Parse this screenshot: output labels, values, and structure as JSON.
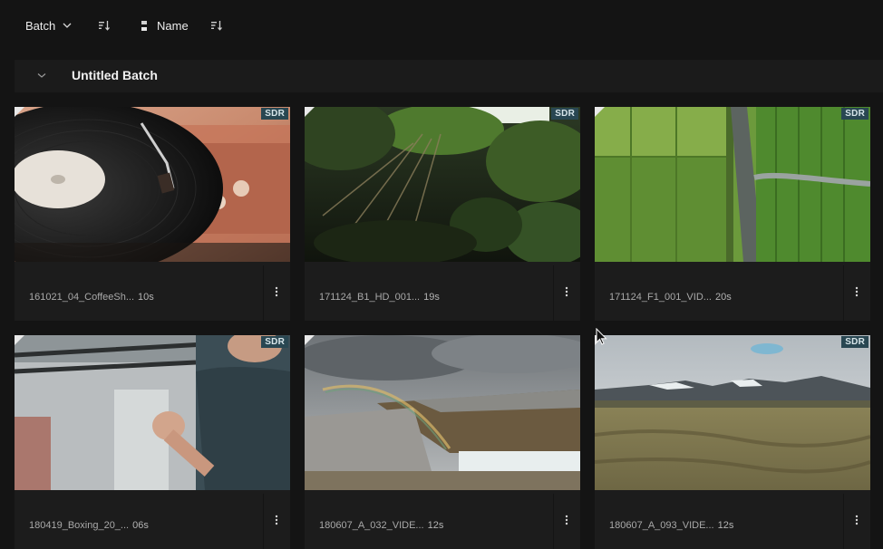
{
  "toolbar": {
    "batch_label": "Batch",
    "name_label": "Name"
  },
  "batch": {
    "title": "Untitled Batch"
  },
  "badge": "SDR",
  "clips": [
    {
      "name": "161021_04_CoffeeSh...",
      "duration": "10s"
    },
    {
      "name": "171124_B1_HD_001...",
      "duration": "19s"
    },
    {
      "name": "171124_F1_001_VID...",
      "duration": "20s"
    },
    {
      "name": "180419_Boxing_20_...",
      "duration": "06s"
    },
    {
      "name": "180607_A_032_VIDE...",
      "duration": "12s"
    },
    {
      "name": "180607_A_093_VIDE...",
      "duration": "12s"
    }
  ],
  "icons": {
    "batch_chevron": "chevron-down-icon",
    "sort": "sort-icon",
    "name_field": "field-icon",
    "collapse": "chevron-down-icon",
    "more": "more-vertical-icon",
    "cursor": "mouse-pointer-icon"
  },
  "colors": {
    "background": "#141414",
    "card": "#1c1c1c",
    "badge": "#294752"
  }
}
